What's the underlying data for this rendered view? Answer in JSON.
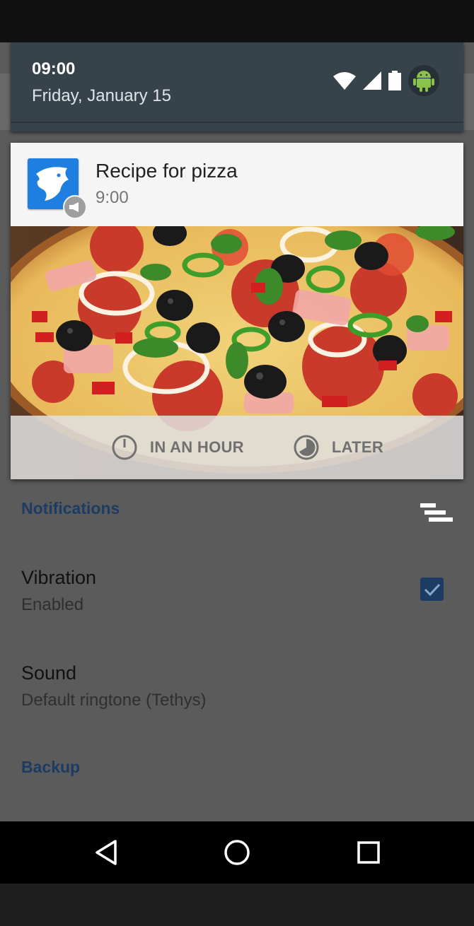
{
  "status": {
    "time": "09:00",
    "date": "Friday, January 15",
    "icons": [
      "wifi-icon",
      "signal-icon",
      "battery-icon",
      "android-icon"
    ]
  },
  "notification": {
    "app_icon": "eagle-app-icon",
    "badge_icon": "megaphone-icon",
    "title": "Recipe for pizza",
    "time": "9:00",
    "image": "pizza-photo",
    "actions": [
      {
        "label": "IN AN HOUR",
        "icon": "clock-icon"
      },
      {
        "label": "LATER",
        "icon": "half-clock-icon"
      }
    ]
  },
  "settings": {
    "notifications_header": "Notifications",
    "vibration": {
      "title": "Vibration",
      "subtitle": "Enabled",
      "checked": true
    },
    "sound": {
      "title": "Sound",
      "subtitle": "Default ringtone (Tethys)"
    },
    "backup_header": "Backup",
    "menu_icon": "sort-menu-icon"
  },
  "navbar": {
    "icons": [
      "back-icon",
      "home-icon",
      "recents-icon"
    ]
  },
  "colors": {
    "accent": "#1d3c63",
    "header_bg": "#37434b",
    "app_icon_blue": "#1e7fe0"
  }
}
